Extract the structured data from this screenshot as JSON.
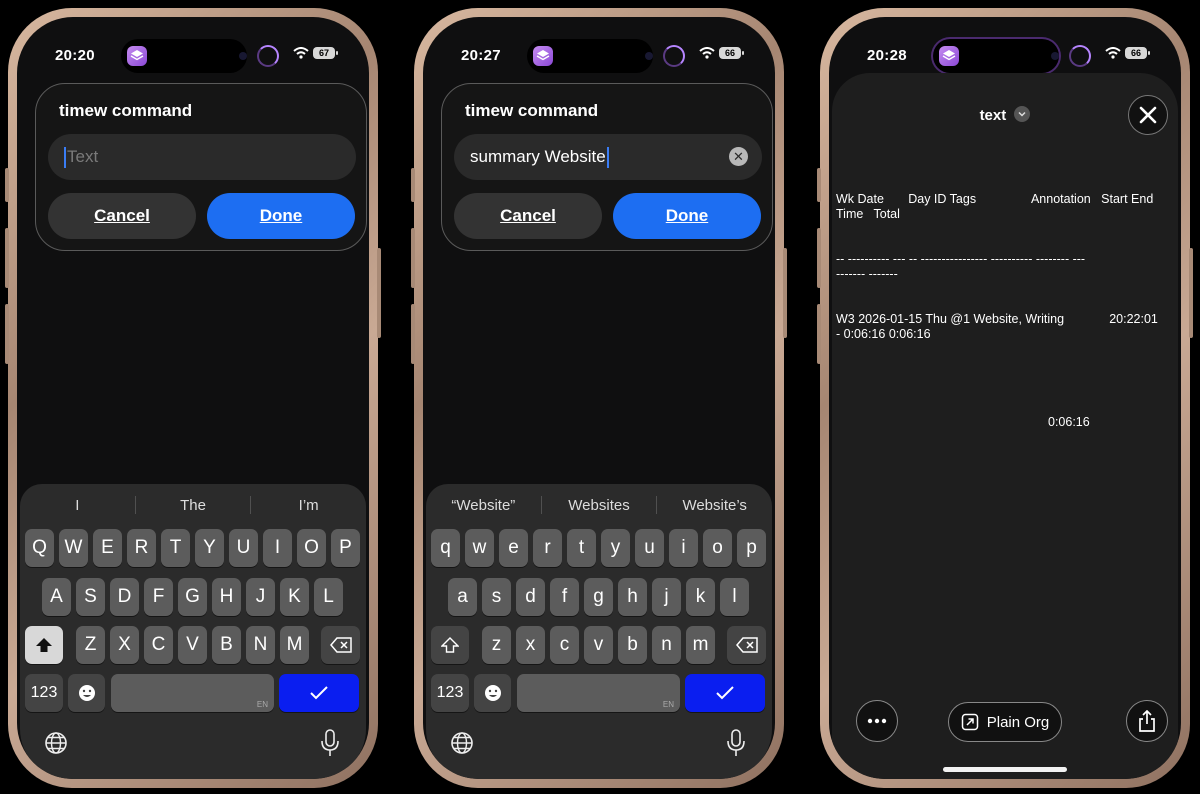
{
  "phones": [
    {
      "time": "20:20",
      "battery": "67",
      "dialog": {
        "title": "timew command",
        "input_value": "",
        "placeholder": "Text",
        "cancel": "Cancel",
        "done": "Done"
      },
      "suggestions": [
        "I",
        "The",
        "I’m"
      ],
      "keys": {
        "row1": [
          "Q",
          "W",
          "E",
          "R",
          "T",
          "Y",
          "U",
          "I",
          "O",
          "P"
        ],
        "row2": [
          "A",
          "S",
          "D",
          "F",
          "G",
          "H",
          "J",
          "K",
          "L"
        ],
        "row3": [
          "Z",
          "X",
          "C",
          "V",
          "B",
          "N",
          "M"
        ],
        "numbers": "123",
        "space_lang": "EN"
      }
    },
    {
      "time": "20:27",
      "battery": "66",
      "dialog": {
        "title": "timew command",
        "input_value": "summary Website",
        "placeholder": "",
        "cancel": "Cancel",
        "done": "Done"
      },
      "suggestions": [
        "“Website”",
        "Websites",
        "Website’s"
      ],
      "keys": {
        "row1": [
          "q",
          "w",
          "e",
          "r",
          "t",
          "y",
          "u",
          "i",
          "o",
          "p"
        ],
        "row2": [
          "a",
          "s",
          "d",
          "f",
          "g",
          "h",
          "j",
          "k",
          "l"
        ],
        "row3": [
          "z",
          "x",
          "c",
          "v",
          "b",
          "n",
          "m"
        ],
        "numbers": "123",
        "space_lang": "EN"
      }
    },
    {
      "time": "20:28",
      "battery": "66",
      "sheet": {
        "title": "text",
        "report_header": "Wk Date       Day ID Tags                Annotation   Start End\nTime   Total",
        "report_rule": "-- ---------- --- -- ---------------- ---------- -------- ---\n------- -------",
        "report_row": "W3 2026-01-15 Thu @1 Website, Writing             20:22:01\n- 0:06:16 0:06:16",
        "report_total": "0:06:16",
        "plain_org": "Plain Org"
      }
    }
  ],
  "icons": [
    "wifi-icon",
    "layers-icon",
    "shift-icon",
    "backspace-icon",
    "emoji-icon",
    "globe-icon",
    "mic-icon",
    "checkmark-icon",
    "close-icon",
    "more-icon",
    "external-link-icon",
    "share-icon"
  ],
  "colors": {
    "accent": "#1d6ef2",
    "go_key": "#0a1ef0",
    "app_icon": "#a468e4",
    "frame": "#c9a994"
  }
}
